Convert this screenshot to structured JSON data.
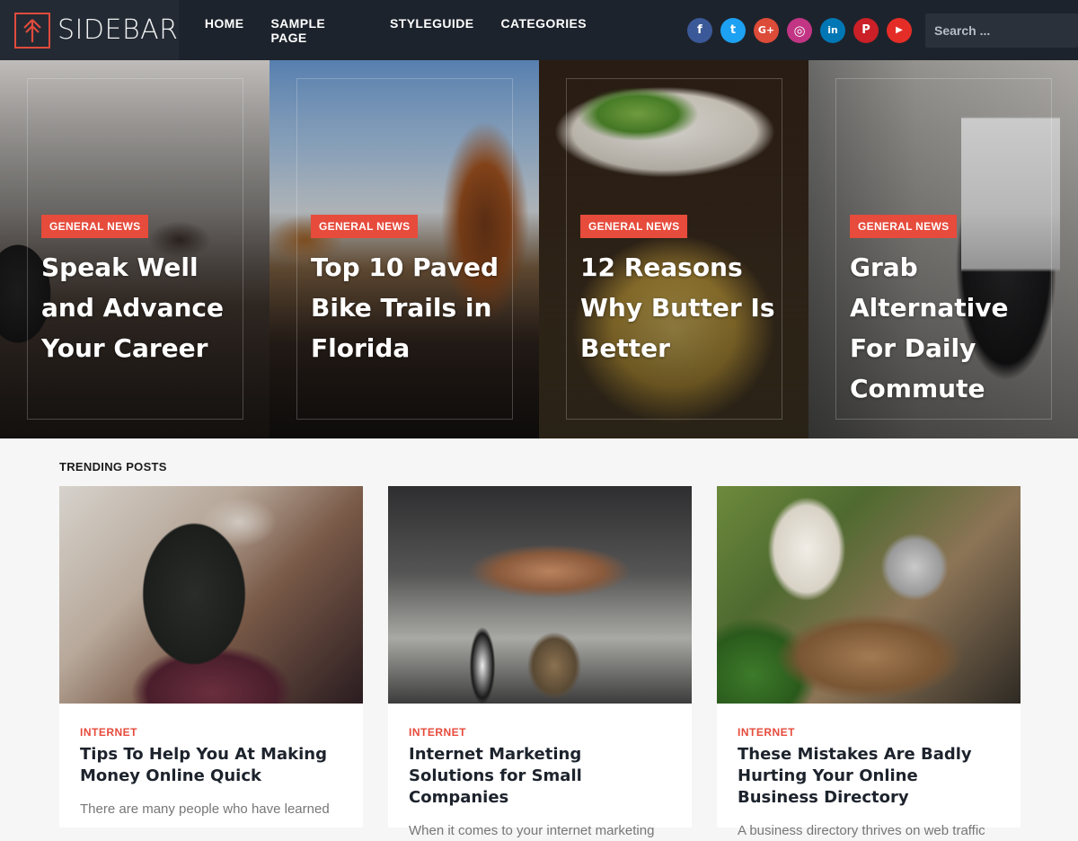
{
  "header": {
    "logo_text": "SIDEBAR",
    "nav": [
      "HOME",
      "SAMPLE PAGE",
      "STYLEGUIDE",
      "CATEGORIES"
    ],
    "socials": [
      {
        "name": "facebook",
        "glyph": "f",
        "color": "#3b5998"
      },
      {
        "name": "twitter",
        "glyph": "t",
        "color": "#1da1f2"
      },
      {
        "name": "google-plus",
        "glyph": "G+",
        "color": "#dd4b39"
      },
      {
        "name": "instagram",
        "glyph": "◎",
        "color": "#c13584"
      },
      {
        "name": "linkedin",
        "glyph": "in",
        "color": "#0077b5"
      },
      {
        "name": "pinterest",
        "glyph": "P",
        "color": "#cb2027"
      },
      {
        "name": "youtube",
        "glyph": "▶",
        "color": "#e52d27"
      }
    ],
    "search_placeholder": "Search ..."
  },
  "slides": [
    {
      "badge": "GENERAL NEWS",
      "title": "Speak Well and Advance Your Career"
    },
    {
      "badge": "GENERAL NEWS",
      "title": "Top 10 Paved Bike Trails in Florida"
    },
    {
      "badge": "GENERAL NEWS",
      "title": "12 Reasons Why Butter Is Better"
    },
    {
      "badge": "GENERAL NEWS",
      "title": "Grab Alternative For Daily Commute"
    }
  ],
  "trending": {
    "heading": "TRENDING POSTS",
    "posts": [
      {
        "category": "INTERNET",
        "title": "Tips To Help You At Making Money Online Quick",
        "excerpt": "There are many people who have learned"
      },
      {
        "category": "INTERNET",
        "title": "Internet Marketing Solutions for Small Companies",
        "excerpt": "When it comes to your internet marketing"
      },
      {
        "category": "INTERNET",
        "title": "These Mistakes Are Badly Hurting Your Online Business Directory",
        "excerpt": "A business directory thrives on web traffic"
      }
    ]
  },
  "colors": {
    "accent": "#e64b3c",
    "header_bg": "#1d232c"
  }
}
